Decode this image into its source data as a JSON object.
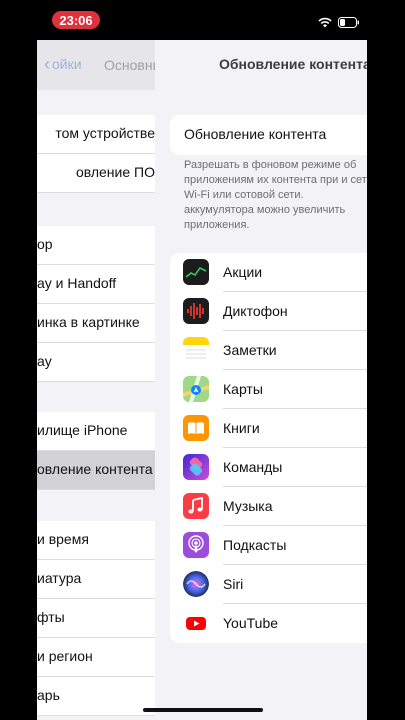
{
  "status_bar": {
    "time": "23:06"
  },
  "left_panel": {
    "back_label": "ойки",
    "title": "Основные",
    "rows": [
      {
        "label": "том устройстве"
      },
      {
        "label": "овление ПО"
      },
      {
        "label": "ор"
      },
      {
        "label": "ay и Handoff"
      },
      {
        "label": "инка в картинке"
      },
      {
        "label": "ay"
      },
      {
        "label": "илище iPhone"
      },
      {
        "label": "овление контента"
      },
      {
        "label": "и время"
      },
      {
        "label": "иатура"
      },
      {
        "label": "фты"
      },
      {
        "label": "и регион"
      },
      {
        "label": "арь"
      }
    ]
  },
  "right_panel": {
    "title": "Обновление контента",
    "main_toggle_label": "Обновление контента",
    "footnote": "Разрешать в фоновом режиме об приложениям их контента при и сети Wi-Fi или сотовой сети. аккумулятора можно увеличить приложения.",
    "apps": [
      {
        "name": "Акции",
        "icon": "stocks-icon",
        "color": "#1c1c1e"
      },
      {
        "name": "Диктофон",
        "icon": "voice-memos-icon",
        "color": "#1c1c1e"
      },
      {
        "name": "Заметки",
        "icon": "notes-icon",
        "color": "#ffd60a"
      },
      {
        "name": "Карты",
        "icon": "maps-icon",
        "color": "#68c35b"
      },
      {
        "name": "Книги",
        "icon": "books-icon",
        "color": "#ff9500"
      },
      {
        "name": "Команды",
        "icon": "shortcuts-icon",
        "color": "#5b4fe0"
      },
      {
        "name": "Музыка",
        "icon": "music-icon",
        "color": "#fc3c44"
      },
      {
        "name": "Подкасты",
        "icon": "podcasts-icon",
        "color": "#9b4dd8"
      },
      {
        "name": "Siri",
        "icon": "siri-icon",
        "color": "#1a1a2e"
      },
      {
        "name": "YouTube",
        "icon": "youtube-icon",
        "color": "#ff0000"
      }
    ]
  }
}
